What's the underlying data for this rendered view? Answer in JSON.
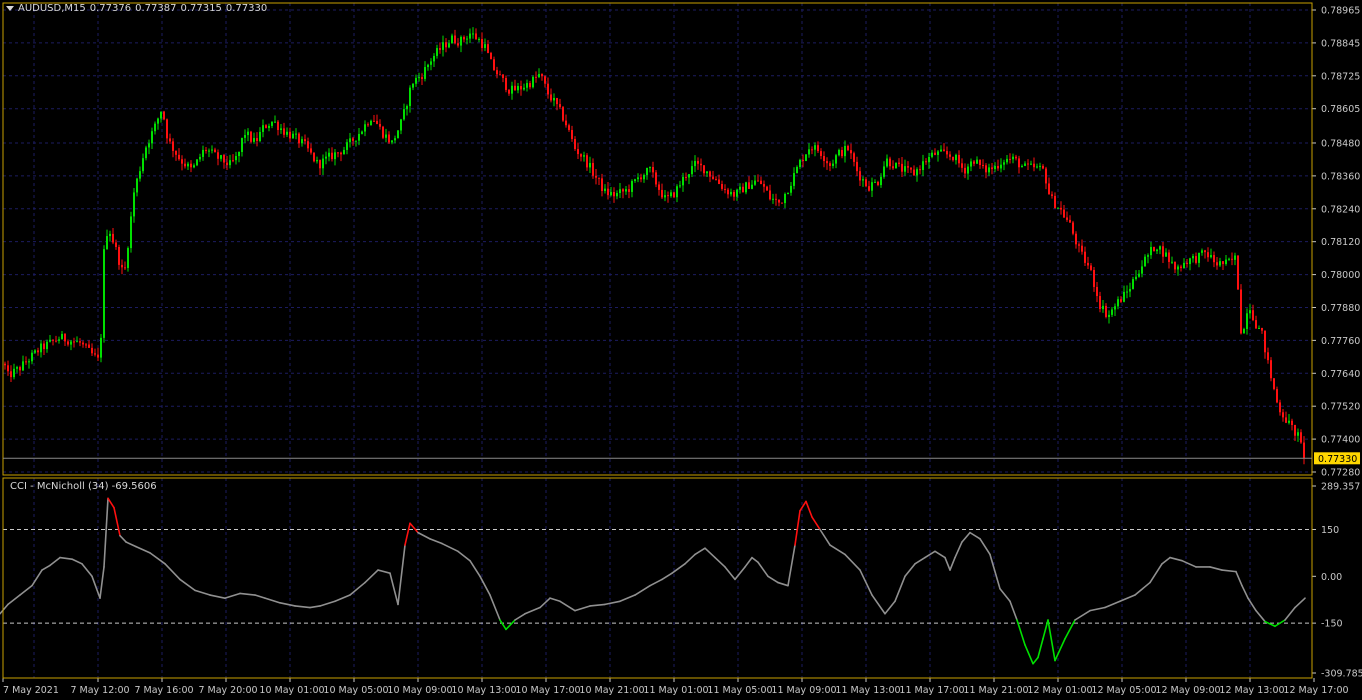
{
  "header": {
    "symbol": "AUDUSD,M15",
    "open": "0.77376",
    "high": "0.77387",
    "low": "0.77315",
    "close": "0.77330"
  },
  "price_axis": {
    "ticks": [
      "0.78965",
      "0.78845",
      "0.78725",
      "0.78605",
      "0.78480",
      "0.78360",
      "0.78240",
      "0.78120",
      "0.78000",
      "0.77880",
      "0.77760",
      "0.77640",
      "0.77520",
      "0.77400",
      "0.77280"
    ],
    "current_price": "0.77330"
  },
  "indicator": {
    "title": "CCI - McNicholl (34)",
    "value": "-69.5606",
    "ticks": [
      "289.357",
      "150",
      "0.00",
      "-150",
      "-309.7855"
    ]
  },
  "time_axis": {
    "labels": [
      "7 May 2021",
      "7 May 12:00",
      "7 May 16:00",
      "7 May 20:00",
      "10 May 01:00",
      "10 May 05:00",
      "10 May 09:00",
      "10 May 13:00",
      "10 May 17:00",
      "10 May 21:00",
      "11 May 01:00",
      "11 May 05:00",
      "11 May 09:00",
      "11 May 13:00",
      "11 May 17:00",
      "11 May 21:00",
      "12 May 01:00",
      "12 May 05:00",
      "12 May 09:00",
      "12 May 13:00",
      "12 May 17:00"
    ]
  },
  "colors": {
    "background": "#000000",
    "grid": "#1c1c60",
    "bull": "#00e000",
    "bear": "#ff1010",
    "cci_line": "#909090",
    "cci_overbought": "#ff1010",
    "cci_oversold": "#00e000",
    "price_tag": "#ffd700",
    "frame": "#c8a000"
  },
  "chart_data": [
    {
      "type": "candlestick",
      "symbol": "AUDUSD",
      "timeframe": "M15",
      "ylim": [
        0.7726,
        0.79
      ],
      "path_x": [
        0,
        8,
        20,
        40,
        60,
        80,
        100,
        104,
        108,
        116,
        124,
        134,
        145,
        155,
        162,
        168,
        180,
        192,
        205,
        216,
        230,
        238,
        244,
        255,
        264,
        273,
        285,
        295,
        305,
        318,
        330,
        345,
        360,
        372,
        382,
        392,
        402,
        412,
        422,
        432,
        442,
        452,
        460,
        470,
        478,
        485,
        492,
        500,
        510,
        520,
        530,
        540,
        548,
        556,
        565,
        575,
        585,
        595,
        605,
        615,
        628,
        640,
        650,
        658,
        666,
        675,
        685,
        695,
        703,
        715,
        725,
        735,
        745,
        755,
        762,
        770,
        780,
        790,
        800,
        810,
        820,
        830,
        838,
        848,
        858,
        868,
        878,
        886,
        894,
        904,
        914,
        924,
        934,
        944,
        954,
        964,
        974,
        984,
        994,
        1004,
        1014,
        1024,
        1034,
        1044,
        1050,
        1060,
        1070,
        1080,
        1090,
        1100,
        1108,
        1118,
        1128,
        1136,
        1146,
        1156,
        1166,
        1176,
        1186,
        1196,
        1206,
        1216,
        1226,
        1236,
        1242,
        1248,
        1256,
        1262,
        1270,
        1278,
        1288,
        1298,
        1305
      ],
      "path_price": [
        0.7772,
        0.7763,
        0.7766,
        0.7773,
        0.7777,
        0.7775,
        0.7768,
        0.7808,
        0.7818,
        0.7809,
        0.7799,
        0.783,
        0.7846,
        0.7854,
        0.7861,
        0.7849,
        0.7842,
        0.7838,
        0.7846,
        0.7843,
        0.784,
        0.7843,
        0.7852,
        0.7848,
        0.7854,
        0.7856,
        0.7852,
        0.785,
        0.7847,
        0.784,
        0.7843,
        0.7846,
        0.7852,
        0.7858,
        0.7852,
        0.7848,
        0.7856,
        0.787,
        0.7873,
        0.7879,
        0.7883,
        0.7886,
        0.7885,
        0.7888,
        0.7886,
        0.7883,
        0.7876,
        0.7872,
        0.7867,
        0.7868,
        0.787,
        0.7873,
        0.7866,
        0.7862,
        0.7856,
        0.7846,
        0.7842,
        0.7836,
        0.783,
        0.7829,
        0.7831,
        0.7836,
        0.7838,
        0.7832,
        0.7827,
        0.783,
        0.7836,
        0.784,
        0.7839,
        0.7835,
        0.7831,
        0.7829,
        0.7832,
        0.7834,
        0.7833,
        0.7828,
        0.7826,
        0.7833,
        0.7841,
        0.7847,
        0.7845,
        0.784,
        0.7844,
        0.7846,
        0.7837,
        0.7832,
        0.7834,
        0.7842,
        0.784,
        0.7838,
        0.7837,
        0.7841,
        0.7844,
        0.7844,
        0.7843,
        0.7838,
        0.7842,
        0.7838,
        0.7839,
        0.7842,
        0.7842,
        0.7839,
        0.7839,
        0.7838,
        0.7828,
        0.7824,
        0.7818,
        0.7808,
        0.7802,
        0.7789,
        0.7785,
        0.779,
        0.7794,
        0.78,
        0.7806,
        0.7811,
        0.7807,
        0.7802,
        0.7805,
        0.7806,
        0.7808,
        0.7804,
        0.7804,
        0.7806,
        0.7775,
        0.779,
        0.7782,
        0.7778,
        0.7764,
        0.7752,
        0.7746,
        0.7741,
        0.7733
      ]
    },
    {
      "type": "line",
      "name": "CCI - McNicholl (34)",
      "ylim": [
        -309.7855,
        289.357
      ],
      "levels": [
        150,
        -150
      ],
      "path_x": [
        0,
        8,
        20,
        32,
        42,
        50,
        60,
        72,
        82,
        92,
        100,
        104,
        108,
        114,
        120,
        126,
        136,
        150,
        165,
        180,
        195,
        210,
        225,
        240,
        255,
        265,
        280,
        295,
        310,
        320,
        335,
        350,
        365,
        378,
        390,
        398,
        405,
        410,
        418,
        430,
        442,
        458,
        470,
        480,
        490,
        500,
        506,
        515,
        525,
        540,
        550,
        560,
        575,
        590,
        605,
        620,
        635,
        650,
        662,
        672,
        685,
        695,
        705,
        715,
        725,
        735,
        745,
        752,
        758,
        768,
        778,
        788,
        795,
        800,
        806,
        812,
        820,
        830,
        845,
        860,
        872,
        885,
        895,
        905,
        915,
        925,
        935,
        945,
        950,
        955,
        962,
        970,
        980,
        990,
        1000,
        1010,
        1017,
        1025,
        1033,
        1038,
        1043,
        1048,
        1055,
        1065,
        1075,
        1090,
        1105,
        1120,
        1135,
        1150,
        1162,
        1170,
        1182,
        1196,
        1210,
        1222,
        1236,
        1242,
        1248,
        1256,
        1265,
        1275,
        1285,
        1295,
        1305
      ],
      "path_values": [
        -120,
        -90,
        -60,
        -30,
        20,
        35,
        60,
        55,
        40,
        0,
        -70,
        30,
        250,
        220,
        130,
        110,
        95,
        75,
        40,
        -10,
        -45,
        -60,
        -70,
        -55,
        -60,
        -70,
        -85,
        -95,
        -100,
        -95,
        -80,
        -60,
        -20,
        20,
        10,
        -90,
        100,
        170,
        140,
        120,
        105,
        80,
        50,
        0,
        -60,
        -140,
        -170,
        -140,
        -120,
        -100,
        -70,
        -80,
        -110,
        -95,
        -90,
        -80,
        -60,
        -30,
        -10,
        10,
        40,
        70,
        90,
        60,
        30,
        -10,
        30,
        60,
        45,
        0,
        -20,
        -30,
        100,
        210,
        240,
        190,
        150,
        100,
        70,
        20,
        -60,
        -120,
        -80,
        0,
        40,
        60,
        80,
        60,
        20,
        60,
        110,
        140,
        120,
        70,
        -40,
        -80,
        -140,
        -220,
        -280,
        -260,
        -200,
        -140,
        -270,
        -200,
        -140,
        -110,
        -100,
        -80,
        -60,
        -20,
        40,
        60,
        50,
        30,
        30,
        20,
        15,
        -30,
        -70,
        -110,
        -145,
        -160,
        -140,
        -100,
        -70
      ]
    }
  ]
}
